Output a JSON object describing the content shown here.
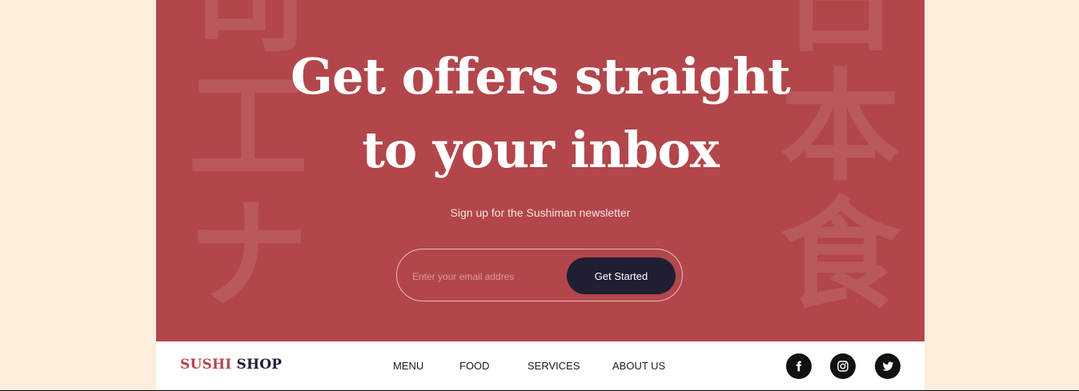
{
  "banner": {
    "headline_line1": "Get offers straight",
    "headline_line2": "to your inbox",
    "subtitle": "Sign up for the Sushiman newsletter",
    "email_placeholder": "Enter your email addres",
    "cta_label": "Get Started",
    "kanji_left": [
      "司",
      "工",
      "ナ"
    ],
    "kanji_right": [
      "日",
      "本",
      "食"
    ]
  },
  "footer": {
    "logo_part1": "SUSHI",
    "logo_part2": "SHOP",
    "nav": [
      "MENU",
      "FOOD",
      "SERVICES",
      "ABOUT US"
    ],
    "social_icons": [
      "facebook-icon",
      "instagram-icon",
      "twitter-icon"
    ]
  },
  "colors": {
    "page_bg": "#fdeedb",
    "banner_bg": "#b2464b",
    "cta_bg": "#1f1e33",
    "logo_accent": "#b2464b"
  }
}
